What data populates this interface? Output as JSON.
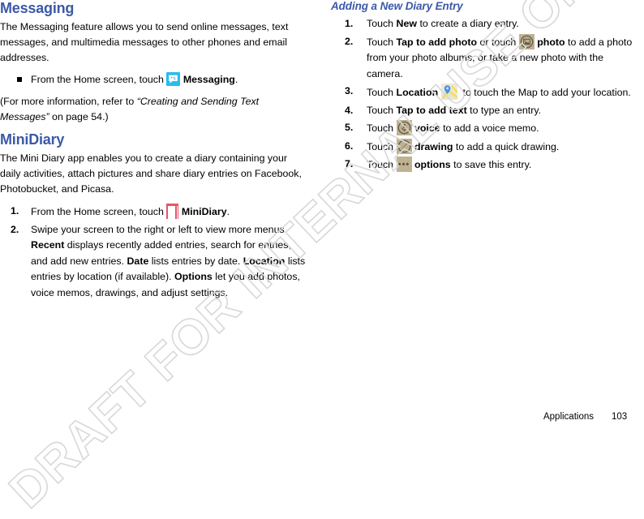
{
  "document": {
    "watermark": "DRAFT FOR INTERNAL USE ONLY",
    "accent_color": "#3b59a8"
  },
  "footer": {
    "section_label": "Applications",
    "page_number": "103"
  },
  "left_column": {
    "messaging": {
      "heading": "Messaging",
      "intro": "The Messaging feature allows you to send online messages, text messages, and multimedia messages to other phones and email addresses.",
      "bullet": {
        "lead": "From the Home screen, touch",
        "icon": "messaging-app-icon",
        "app_name": "Messaging",
        "trailing": "."
      },
      "note_prefix": "(For more information, refer to ",
      "note_italic": "“Creating and Sending Text Messages”",
      "note_suffix": " on page 54.)"
    },
    "minidiary": {
      "heading": "MiniDiary",
      "intro": "The Mini Diary app enables you to create a diary containing your daily activities, attach pictures and share diary entries on Facebook, Photobucket, and Picasa.",
      "steps": [
        {
          "number": "1.",
          "lead": "From the Home screen, touch",
          "icon": "minidiary-app-icon",
          "app_name": "MiniDiary",
          "trailing": "."
        },
        {
          "number": "2.",
          "part1": "Swipe your screen to the right or left to view more menus. ",
          "b1": "Recent",
          "part2": " displays recently added entries, search for entries, and add new entries. ",
          "b2": "Date",
          "part3": " lists entries by date. ",
          "b3": "Location",
          "part4": " lists entries by location (if available). ",
          "b4": "Options",
          "part5": " let you add photos, voice memos, drawings, and adjust settings."
        }
      ]
    }
  },
  "right_column": {
    "heading": "Adding a New Diary Entry",
    "steps": [
      {
        "number": "1.",
        "pre": "Touch ",
        "bold": "New",
        "post": " to create a diary entry."
      },
      {
        "number": "2.",
        "pre": "Touch ",
        "bold": "Tap to add photo",
        "mid": " or touch ",
        "icon": "photo-icon",
        "bold2": "photo",
        "post": " to add a photo from your photo albums, or take a new photo with the camera."
      },
      {
        "number": "3.",
        "pre": "Touch ",
        "bold": "Location",
        "icon": "location-map-icon",
        "post": " to touch the Map to add your location."
      },
      {
        "number": "4.",
        "pre": "Touch ",
        "bold": "Tap to add text",
        "post": " to type an entry."
      },
      {
        "number": "5.",
        "pre": "Touch ",
        "icon": "voice-microphone-icon",
        "bold": "voice",
        "post": " to add a voice memo."
      },
      {
        "number": "6.",
        "pre": "Touch ",
        "icon": "drawing-pen-icon",
        "bold": "drawing",
        "post": " to add a quick drawing."
      },
      {
        "number": "7.",
        "pre": "Touch ",
        "icon": "options-ellipsis-icon",
        "bold": "options",
        "post": " to save this entry.",
        "dots": "•••"
      }
    ]
  }
}
